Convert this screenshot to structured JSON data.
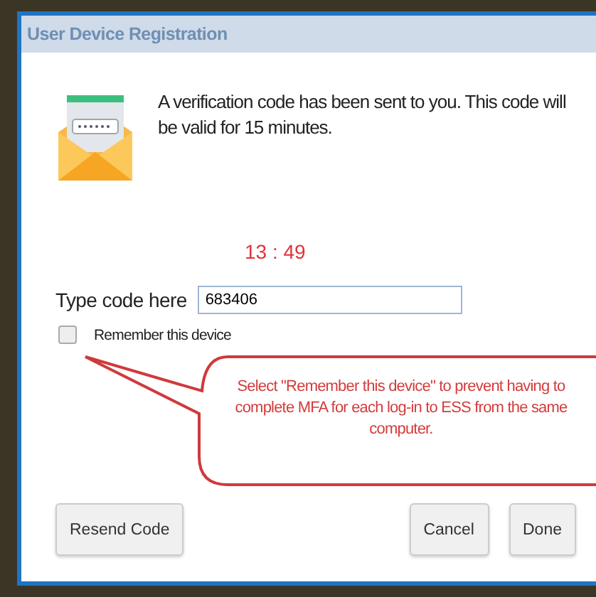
{
  "window": {
    "title": "User Device Registration"
  },
  "message": "A verification code has been sent to you. This code will be valid for 15 minutes.",
  "timer": "13 : 49",
  "code_field": {
    "label": "Type code here",
    "value": "683406"
  },
  "remember": {
    "label": "Remember this device",
    "checked": false
  },
  "callout": {
    "text": "Select \"Remember this device\" to prevent having to complete MFA for each log-in to ESS from the same computer."
  },
  "buttons": [
    {
      "label": "Resend Code",
      "kind": "left"
    },
    {
      "label": "Cancel",
      "kind": "right"
    },
    {
      "label": "Done",
      "kind": "right"
    }
  ]
}
